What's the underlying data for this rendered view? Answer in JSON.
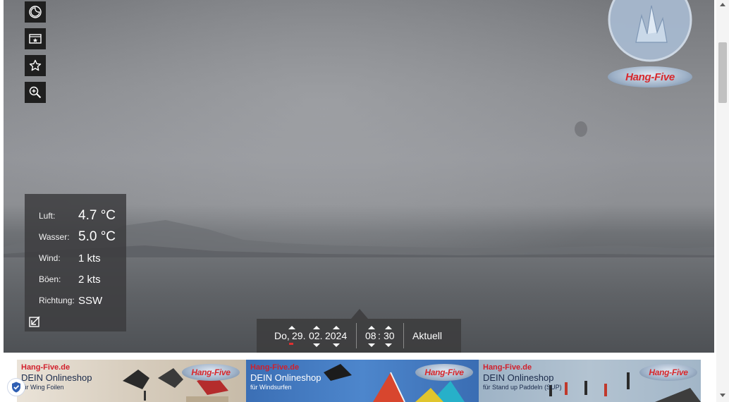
{
  "toolbar": {
    "buttons": [
      {
        "icon": "moon-clock-icon"
      },
      {
        "icon": "gallery-star-icon"
      },
      {
        "icon": "star-icon"
      },
      {
        "icon": "zoom-in-icon"
      }
    ]
  },
  "weather": {
    "air_label": "Luft:",
    "air_value": "4.7 °C",
    "water_label": "Wasser:",
    "water_value": "5.0 °C",
    "wind_label": "Wind:",
    "wind_value": "1 kts",
    "gusts_label": "Böen:",
    "gusts_value": "2 kts",
    "direction_label": "Richtung:",
    "direction_value": "SSW"
  },
  "datetime": {
    "weekday": "Do,",
    "day": "29.",
    "month": "02.",
    "year": "2024",
    "hour": "08",
    "colon": ":",
    "minute": "30",
    "current_label": "Aktuell"
  },
  "ads": [
    {
      "brand": "Hang-Five.de",
      "title": "DEIN Onlineshop",
      "sub": "für Wing Foilen",
      "logo": "Hang-Five"
    },
    {
      "brand": "Hang-Five.de",
      "title": "DEIN Onlineshop",
      "sub": "für Windsurfen",
      "logo": "Hang-Five"
    },
    {
      "brand": "Hang-Five.de",
      "title": "DEIN Onlineshop",
      "sub": "für Stand up Paddeln (SUP)",
      "logo": "Hang-Five"
    }
  ],
  "logo": {
    "text": "Hang-Five"
  },
  "colors": {
    "panel": "#3c3c3e",
    "accent_red": "#d21f2b",
    "today_marker": "#e03030"
  }
}
